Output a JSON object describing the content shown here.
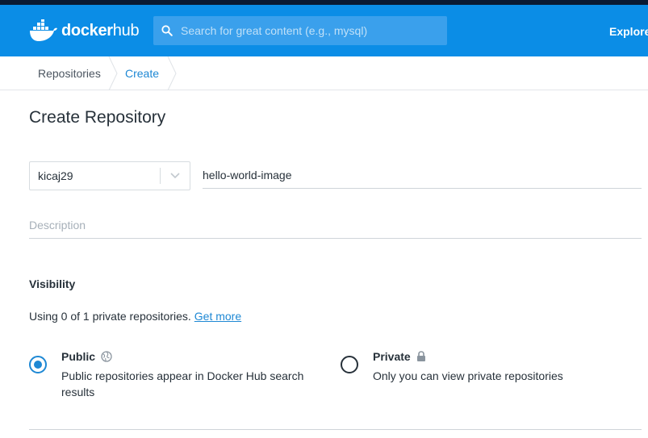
{
  "header": {
    "logo_word": "docker",
    "logo_hub": "hub",
    "search_placeholder": "Search for great content (e.g., mysql)",
    "explore_label": "Explore"
  },
  "breadcrumb": {
    "items": [
      {
        "label": "Repositories"
      },
      {
        "label": "Create"
      }
    ]
  },
  "page": {
    "title": "Create Repository"
  },
  "form": {
    "namespace_value": "kicaj29",
    "repo_name_value": "hello-world-image",
    "description_placeholder": "Description",
    "visibility_heading": "Visibility",
    "usage_text": "Using 0 of 1 private repositories.",
    "get_more_label": "Get more",
    "options": [
      {
        "title": "Public",
        "description": "Public repositories appear in Docker Hub search results",
        "selected": true,
        "icon": "globe-icon"
      },
      {
        "title": "Private",
        "description": "Only you can view private repositories",
        "selected": false,
        "icon": "lock-icon"
      }
    ]
  },
  "colors": {
    "brand_blue": "#0b8de6",
    "top_stripe": "#0a1a33",
    "link_blue": "#1e88d4"
  }
}
